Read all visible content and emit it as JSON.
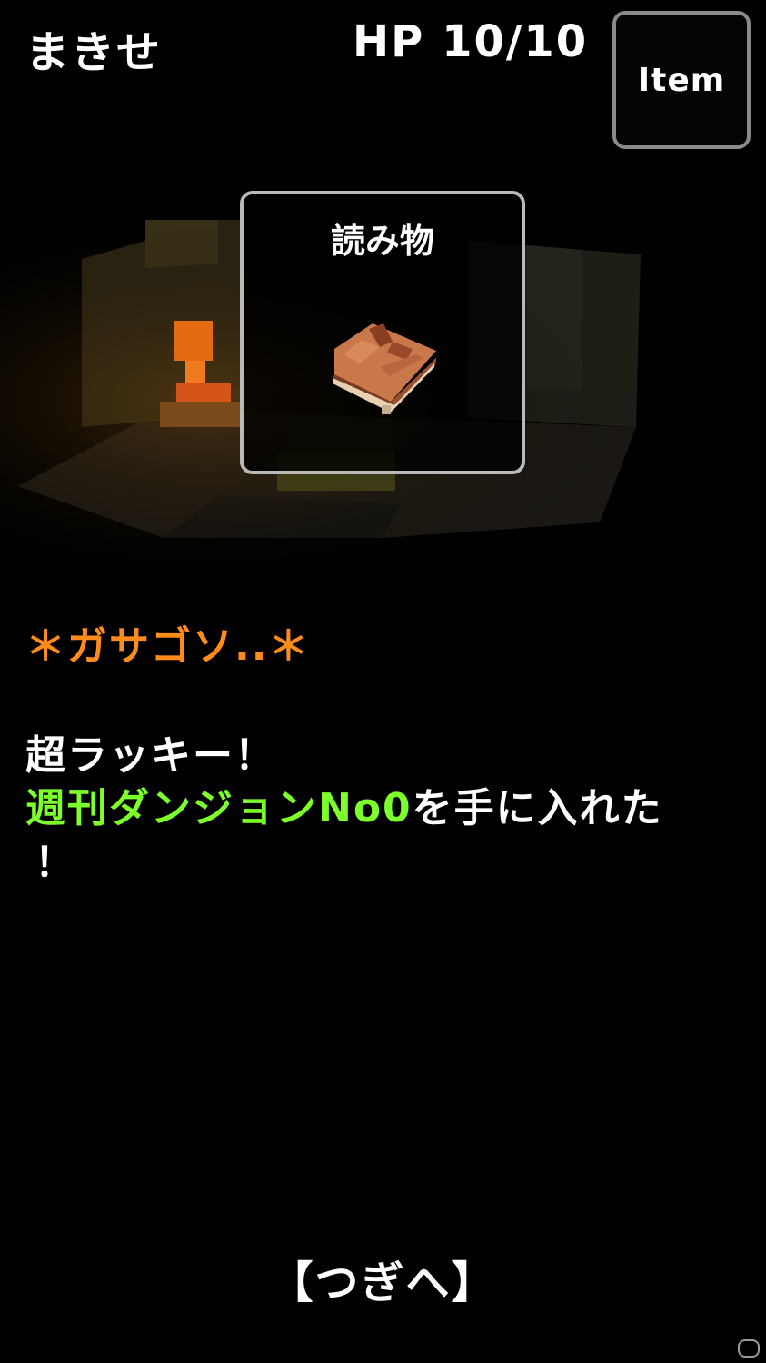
{
  "hud": {
    "player_name": "まきせ",
    "hp_label": "HP 10/10",
    "item_button_label": "Item"
  },
  "popup": {
    "category": "読み物",
    "icon": "book-icon"
  },
  "messages": {
    "sound_effect": "＊ガサゴソ..＊",
    "lucky": "超ラッキー！",
    "item_name": "週刊ダンジョンNo0",
    "acquired_suffix": "を手に入れた",
    "exclamation": "！"
  },
  "footer": {
    "next_label": "【つぎへ】"
  },
  "colors": {
    "sound_effect": "#ff8c1a",
    "item_name": "#7cff2a",
    "background": "#000000"
  }
}
